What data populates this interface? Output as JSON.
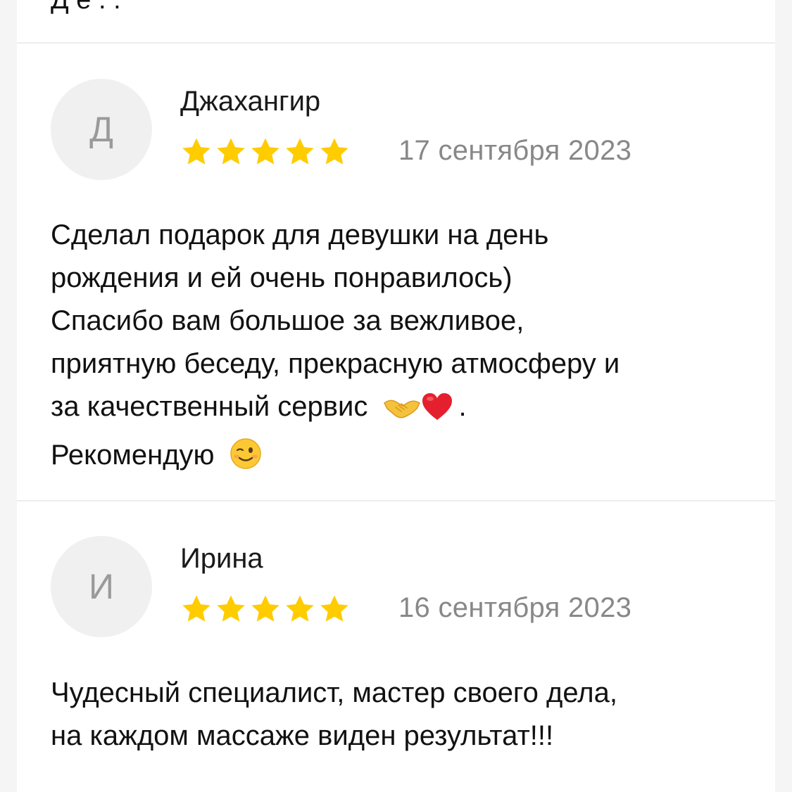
{
  "top_partial_text": "Д е . .",
  "reviews": [
    {
      "avatar_letter": "Д",
      "author": "Джахангир",
      "rating": 5,
      "date": "17 сентября 2023",
      "lines": [
        "Сделал подарок для девушки на день",
        "рождения и ей очень понравилось)",
        "Спасибо вам большое за вежливое,",
        "приятную беседу, прекрасную атмосферу и",
        "за качественный сервис",
        ".",
        "Рекомендую"
      ],
      "emojis": [
        "handshake-emoji",
        "red-heart-emoji",
        "winking-face-emoji"
      ]
    },
    {
      "avatar_letter": "И",
      "author": "Ирина",
      "rating": 5,
      "date": "16 сентября 2023",
      "lines": [
        "Чудесный специалист, мастер своего дела,",
        "на каждом массаже виден результат!!!"
      ]
    }
  ],
  "colors": {
    "star": "#FFCC00",
    "avatar_bg": "#F0F0F0",
    "date_text": "#888888",
    "divider": "#EDEDED"
  }
}
